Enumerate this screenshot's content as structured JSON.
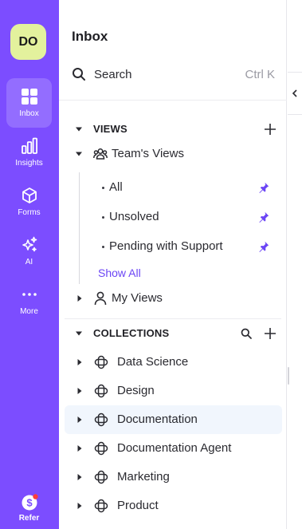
{
  "account": {
    "initials": "DO",
    "avatar_color": "#e3f19d"
  },
  "rail": {
    "background": "#7c4dff",
    "items": [
      {
        "label": "Inbox",
        "icon": "grid-icon",
        "active": true
      },
      {
        "label": "Insights",
        "icon": "bar-chart-icon"
      },
      {
        "label": "Forms",
        "icon": "cube-icon"
      },
      {
        "label": "AI",
        "icon": "sparkles-icon"
      },
      {
        "label": "More",
        "icon": "more-dots-icon"
      }
    ],
    "refer": {
      "label": "Refer",
      "icon": "dollar-coin-icon",
      "badge_color": "#ff3b3b"
    }
  },
  "panel": {
    "title": "Inbox",
    "search": {
      "label": "Search",
      "shortcut": "Ctrl K"
    },
    "views": {
      "section_label": "VIEWS",
      "team_views": {
        "label": "Team's Views",
        "items": [
          {
            "label": "All",
            "pinned": true
          },
          {
            "label": "Unsolved",
            "pinned": true
          },
          {
            "label": "Pending with Support",
            "pinned": true
          }
        ],
        "show_all": "Show All"
      },
      "my_views": {
        "label": "My Views"
      }
    },
    "collections": {
      "section_label": "COLLECTIONS",
      "items": [
        {
          "label": "Data Science"
        },
        {
          "label": "Design"
        },
        {
          "label": "Documentation",
          "selected": true
        },
        {
          "label": "Documentation Agent"
        },
        {
          "label": "Marketing"
        },
        {
          "label": "Product"
        }
      ]
    }
  },
  "colors": {
    "accent": "#6b45f5",
    "pin": "#6b45f5",
    "selected_row": "#f1f6fd"
  }
}
